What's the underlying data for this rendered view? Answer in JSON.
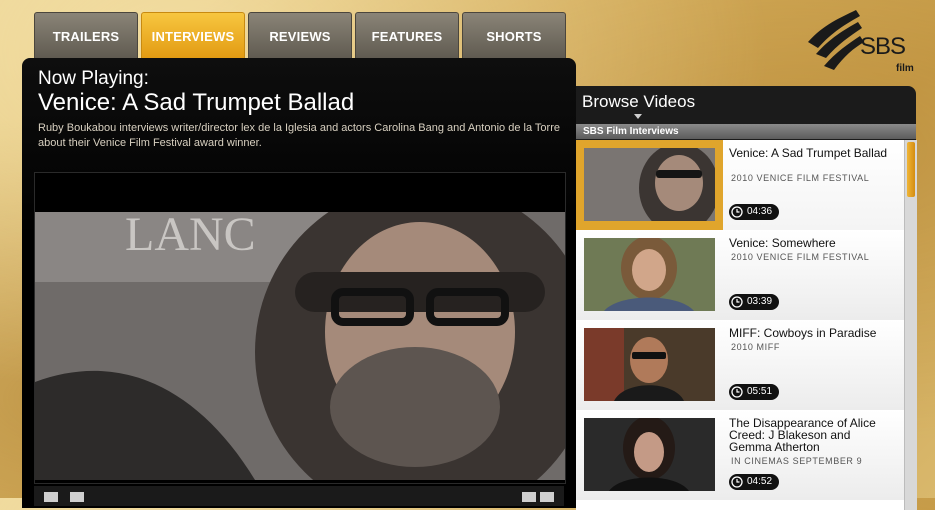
{
  "tabs": [
    {
      "label": "TRAILERS",
      "active": false
    },
    {
      "label": "INTERVIEWS",
      "active": true
    },
    {
      "label": "REVIEWS",
      "active": false
    },
    {
      "label": "FEATURES",
      "active": false
    },
    {
      "label": "SHORTS",
      "active": false
    }
  ],
  "logo": {
    "text": "SBS",
    "sub": "film"
  },
  "player": {
    "now_playing_label": "Now Playing:",
    "title": "Venice: A Sad Trumpet Ballad",
    "description": "Ruby Boukabou interviews writer/director lex de la Iglesia and actors Carolina Bang and Antonio de la Torre about their Venice Film Festival award winner."
  },
  "browse": {
    "title": "Browse Videos",
    "category": "SBS Film Interviews",
    "items": [
      {
        "title": "Venice: A Sad Trumpet Ballad",
        "subtitle": "2010 VENICE FILM FESTIVAL",
        "duration": "04:36",
        "selected": true
      },
      {
        "title": "Venice: Somewhere",
        "subtitle": "2010 VENICE FILM FESTIVAL",
        "duration": "03:39",
        "selected": false
      },
      {
        "title": "MIFF: Cowboys in Paradise",
        "subtitle": "2010 MIFF",
        "duration": "05:51",
        "selected": false
      },
      {
        "title": "The Disappearance of Alice Creed: J Blakeson and Gemma Atherton",
        "subtitle": "IN CINEMAS SEPTEMBER 9",
        "duration": "04:52",
        "selected": false
      }
    ]
  },
  "colors": {
    "accent": "#e8a81f",
    "panel": "#000000",
    "tab": "#6f6a60"
  }
}
